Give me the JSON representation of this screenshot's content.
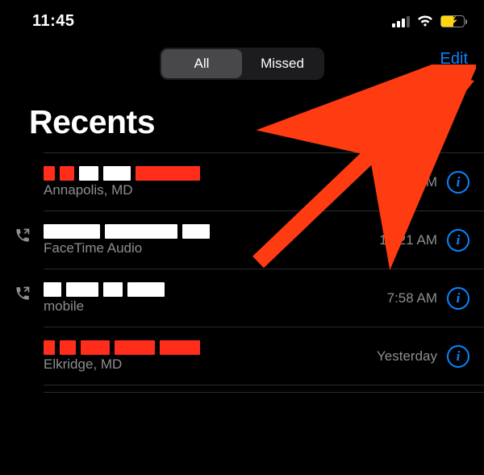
{
  "status": {
    "time": "11:45"
  },
  "nav": {
    "seg_all": "All",
    "seg_missed": "Missed",
    "edit": "Edit"
  },
  "page": {
    "title": "Recents"
  },
  "calls": [
    {
      "subtitle": "Annapolis, MD",
      "time": "11:34 AM",
      "missed": true,
      "outgoing": false
    },
    {
      "subtitle": "FaceTime Audio",
      "time": "10:21 AM",
      "missed": false,
      "outgoing": true
    },
    {
      "subtitle": "mobile",
      "time": "7:58 AM",
      "missed": false,
      "outgoing": true
    },
    {
      "subtitle": "Elkridge, MD",
      "time": "Yesterday",
      "missed": true,
      "outgoing": false
    }
  ],
  "colors": {
    "accent": "#0a84ff",
    "missed": "#ff453a",
    "battery_fill": "#ffd60a"
  },
  "annotation": {
    "type": "arrow",
    "target": "edit-button",
    "color": "#ff3b12"
  }
}
